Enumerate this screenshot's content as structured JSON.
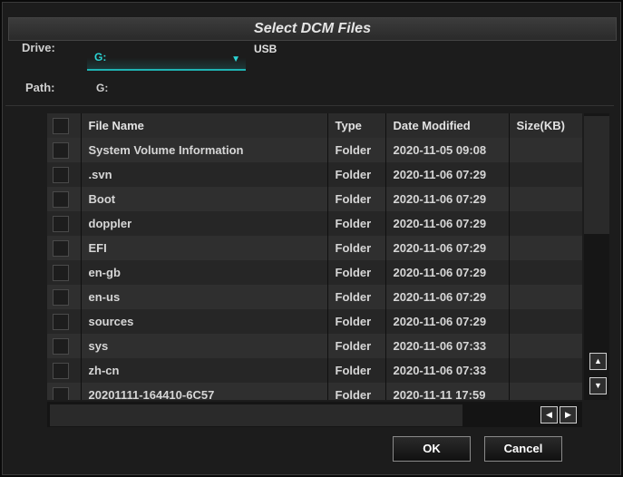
{
  "dialog": {
    "title": "Select DCM Files"
  },
  "drive": {
    "label": "Drive:",
    "value": "G:",
    "description": "USB"
  },
  "path": {
    "label": "Path:",
    "value": "G:"
  },
  "columns": [
    "File Name",
    "Type",
    "Date Modified",
    "Size(KB)"
  ],
  "rows": [
    {
      "name": "System Volume Information",
      "type": "Folder",
      "date": "2020-11-05 09:08",
      "size": ""
    },
    {
      "name": ".svn",
      "type": "Folder",
      "date": "2020-11-06 07:29",
      "size": ""
    },
    {
      "name": "Boot",
      "type": "Folder",
      "date": "2020-11-06 07:29",
      "size": ""
    },
    {
      "name": "doppler",
      "type": "Folder",
      "date": "2020-11-06 07:29",
      "size": ""
    },
    {
      "name": "EFI",
      "type": "Folder",
      "date": "2020-11-06 07:29",
      "size": ""
    },
    {
      "name": "en-gb",
      "type": "Folder",
      "date": "2020-11-06 07:29",
      "size": ""
    },
    {
      "name": "en-us",
      "type": "Folder",
      "date": "2020-11-06 07:29",
      "size": ""
    },
    {
      "name": "sources",
      "type": "Folder",
      "date": "2020-11-06 07:29",
      "size": ""
    },
    {
      "name": "sys",
      "type": "Folder",
      "date": "2020-11-06 07:33",
      "size": ""
    },
    {
      "name": "zh-cn",
      "type": "Folder",
      "date": "2020-11-06 07:33",
      "size": ""
    },
    {
      "name": "20201111-164410-6C57",
      "type": "Folder",
      "date": "2020-11-11 17:59",
      "size": ""
    }
  ],
  "buttons": {
    "ok": "OK",
    "cancel": "Cancel"
  },
  "scroll_icons": {
    "up": "triangle-up-icon",
    "down": "triangle-down-icon",
    "left": "triangle-left-icon",
    "right": "triangle-right-icon"
  },
  "colors": {
    "accent": "#1fb3b3",
    "accent_text": "#2bd6d6",
    "background": "#1c1c1c"
  }
}
